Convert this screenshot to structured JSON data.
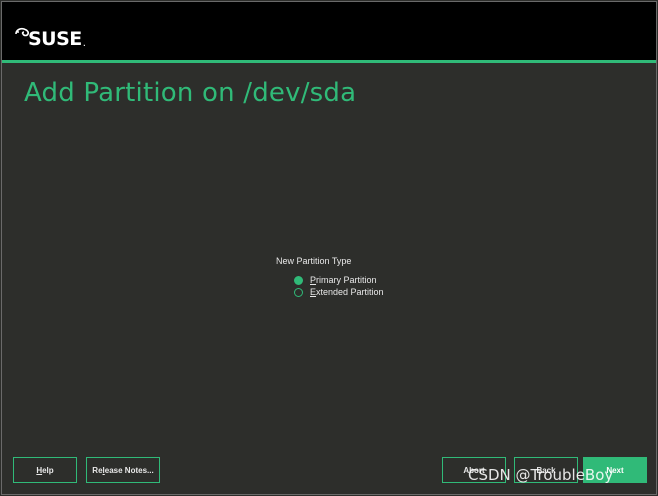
{
  "app": {
    "logo_text": "SUSE",
    "logo_dot": "."
  },
  "page": {
    "title": "Add Partition on /dev/sda"
  },
  "partition_type": {
    "label": "New Partition Type",
    "options": [
      {
        "label": "Primary Partition",
        "mnemonic": "P",
        "rest": "rimary Partition",
        "selected": true
      },
      {
        "label": "Extended Partition",
        "mnemonic": "E",
        "rest": "xtended Partition",
        "selected": false
      }
    ]
  },
  "footer": {
    "help_mn": "H",
    "help_rest": "elp",
    "release_notes_pre": "Re",
    "release_notes_mn": "l",
    "release_notes_rest": "ease Notes...",
    "abort_label": "Abort",
    "back_label": "Back",
    "next_label": "Next"
  },
  "watermark": "CSDN @TroubleBoy",
  "colors": {
    "accent": "#30ba78",
    "background": "#2d2e2b",
    "header": "#000000"
  }
}
